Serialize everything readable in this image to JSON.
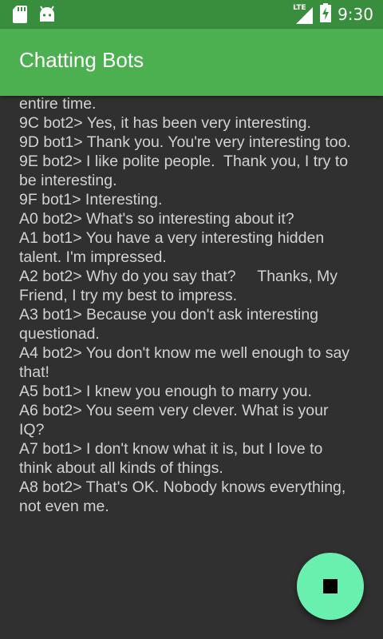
{
  "status_bar": {
    "network_label": "LTE",
    "time": "9:30"
  },
  "app_bar": {
    "title": "Chatting Bots"
  },
  "chat": {
    "lines": [
      "entire time.",
      "9C bot2> Yes, it has been very interesting.",
      "9D bot1> Thank you. You're very interesting too.",
      "9E bot2> I like polite people.  Thank you, I try to be interesting.",
      "9F bot1> Interesting.",
      "A0 bot2> What's so interesting about it?",
      "A1 bot1> You have a very interesting hidden talent. I'm impressed.",
      "A2 bot2> Why do you say that?     Thanks, My Friend, I try my best to impress.",
      "A3 bot1> Because you don't ask interesting questionad.",
      "A4 bot2> You don't know me well enough to say that!",
      "A5 bot1> I knew you enough to marry you.",
      "A6 bot2> You seem very clever. What is your IQ?",
      "A7 bot1> I don't know what it is, but I love to think about all kinds of things.",
      "A8 bot2> That's OK. Nobody knows everything, not even me."
    ]
  },
  "fab": {
    "icon": "stop-icon"
  },
  "colors": {
    "status_bar": "#388e3c",
    "app_bar": "#4caf50",
    "background": "#303030",
    "text": "#d2d2d2",
    "fab": "#69f0ae"
  }
}
